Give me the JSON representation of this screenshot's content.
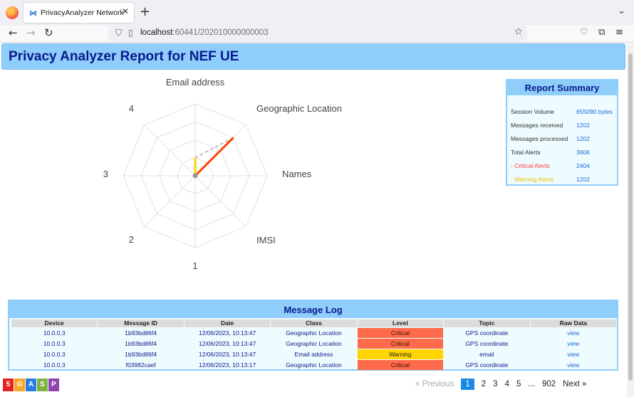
{
  "browser": {
    "tab_title": "PrivacyAnalyzer Network Applic",
    "url_host": "localhost",
    "url_rest": ":60441/202010000000003"
  },
  "header": {
    "title": "Privacy Analyzer Report for NEF UE"
  },
  "chart_data": {
    "type": "radar",
    "axes": [
      "Email address",
      "Geographic Location",
      "Names",
      "IMSI",
      "1",
      "2",
      "3",
      "4"
    ],
    "scale_labels": [
      "1",
      "2",
      "3",
      "4"
    ],
    "series": [
      {
        "color": "#ff4500",
        "values": [
          0,
          3,
          0,
          0,
          0,
          0,
          0,
          0
        ]
      },
      {
        "color": "#ffd400",
        "values": [
          1,
          0,
          0,
          0,
          0,
          0,
          0,
          0
        ]
      }
    ],
    "rmax": 4,
    "rings": 4
  },
  "summary": {
    "title": "Report Summary",
    "rows": [
      {
        "label": "Session Volume",
        "value": "655090 bytes"
      },
      {
        "label": "Messages received",
        "value": "1202"
      },
      {
        "label": "Messages processed",
        "value": "1202"
      },
      {
        "label": "Total Alerts",
        "value": "3606"
      },
      {
        "label": "- Critical Alerts",
        "value": "2404"
      },
      {
        "label": "- Warning Alerts",
        "value": "1202"
      }
    ]
  },
  "log": {
    "title": "Message Log",
    "columns": [
      "Device",
      "Message ID",
      "Date",
      "Class",
      "Level",
      "Topic",
      "Raw Data"
    ],
    "rows": [
      {
        "device": "10.0.0.3",
        "id": "1b93bd86f4",
        "date": "12/06/2023, 10:13:47",
        "class": "Geographic Location",
        "level": "Critical",
        "topic": "GPS coordinate",
        "raw": "view"
      },
      {
        "device": "10.0.0.3",
        "id": "1b93bd86f4",
        "date": "12/06/2023, 10:13:47",
        "class": "Geographic Location",
        "level": "Critical",
        "topic": "GPS coordinate",
        "raw": "view"
      },
      {
        "device": "10.0.0.3",
        "id": "1b93bd86f4",
        "date": "12/06/2023, 10:13:47",
        "class": "Email address",
        "level": "Warning",
        "topic": "email",
        "raw": "view"
      },
      {
        "device": "10.0.0.3",
        "id": "f03982caef",
        "date": "12/06/2023, 10:13:17",
        "class": "Geographic Location",
        "level": "Critical",
        "topic": "GPS coordinate",
        "raw": "view"
      }
    ]
  },
  "logo": {
    "letters": [
      "5",
      "G",
      "A",
      "S",
      "P"
    ],
    "colors": [
      "#e32222",
      "#f5a623",
      "#2a7de1",
      "#7cb342",
      "#8e44ad"
    ]
  },
  "pager": {
    "previous": "« Previous",
    "pages": [
      "1",
      "2",
      "3",
      "4",
      "5",
      "...",
      "902"
    ],
    "active": "1",
    "next": "Next »"
  }
}
